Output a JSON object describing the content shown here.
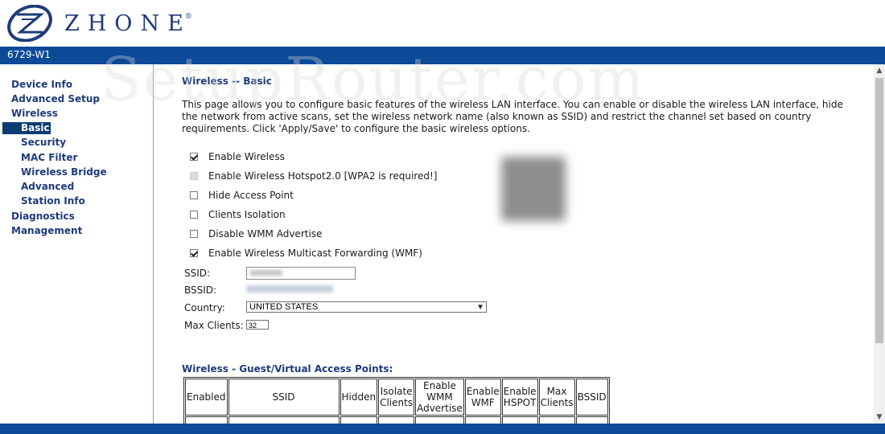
{
  "header": {
    "brand": "ZHONE",
    "reg_mark": "®",
    "model": "6729-W1"
  },
  "watermark": "SetupRouter.com",
  "sidebar": {
    "items": [
      {
        "label": "Device Info"
      },
      {
        "label": "Advanced Setup"
      },
      {
        "label": "Wireless"
      },
      {
        "label": "Basic"
      },
      {
        "label": "Security"
      },
      {
        "label": "MAC Filter"
      },
      {
        "label": "Wireless Bridge"
      },
      {
        "label": "Advanced"
      },
      {
        "label": "Station Info"
      },
      {
        "label": "Diagnostics"
      },
      {
        "label": "Management"
      }
    ]
  },
  "main": {
    "title": "Wireless -- Basic",
    "description": "This page allows you to configure basic features of the wireless LAN interface. You can enable or disable the wireless LAN interface, hide the network from active scans, set the wireless network name (also known as SSID) and restrict the channel set based on country requirements. Click 'Apply/Save' to configure the basic wireless options.",
    "options": [
      {
        "label": "Enable Wireless",
        "checked": true
      },
      {
        "label": "Enable Wireless Hotspot2.0 [WPA2 is required!]",
        "checked": false,
        "disabled": true
      },
      {
        "label": "Hide Access Point",
        "checked": false
      },
      {
        "label": "Clients Isolation",
        "checked": false
      },
      {
        "label": "Disable WMM Advertise",
        "checked": false
      },
      {
        "label": "Enable Wireless Multicast Forwarding (WMF)",
        "checked": true
      }
    ],
    "ssid_label": "SSID:",
    "bssid_label": "BSSID:",
    "country_label": "Country:",
    "country_value": "UNITED STATES",
    "max_clients_label": "Max Clients:",
    "max_clients_value": "32"
  },
  "guest": {
    "title": "Wireless - Guest/Virtual Access Points:",
    "headers": {
      "enabled": "Enabled",
      "ssid": "SSID",
      "hidden": "Hidden",
      "isolate_1": "Isolate",
      "isolate_2": "Clients",
      "wmm_1": "Enable",
      "wmm_2": "WMM",
      "wmm_3": "Advertise",
      "wmf_1": "Enable",
      "wmf_2": "WMF",
      "hspot_1": "Enable",
      "hspot_2": "HSPOT",
      "max_1": "Max",
      "max_2": "Clients",
      "bssid": "BSSID"
    }
  },
  "colors": {
    "brand_blue": "#0c4a98",
    "nav_text": "#1f3b7a",
    "nav_active": "#0c3b73"
  }
}
